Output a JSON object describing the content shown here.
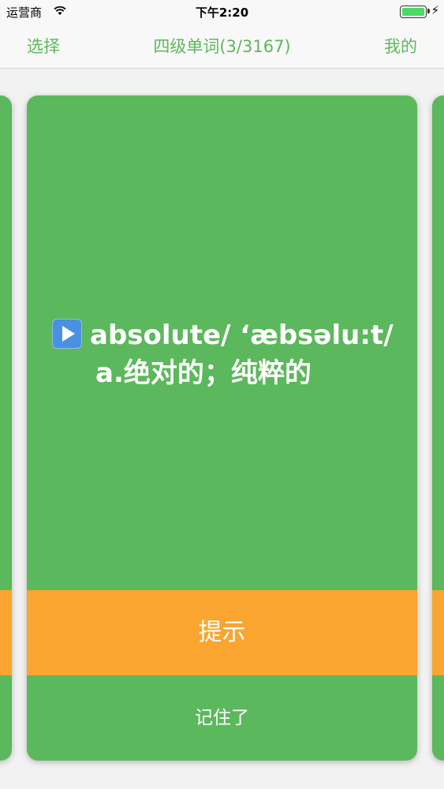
{
  "status": {
    "carrier": "运营商",
    "time": "下午2:20"
  },
  "nav": {
    "left": "选择",
    "title": "四级单词(3/3167)",
    "right": "我的"
  },
  "card": {
    "word": "absolute/ ‘æbsəlu:t/",
    "meaning": "a.绝对的；纯粹的",
    "hint_label": "提示",
    "remember_label": "记住了"
  },
  "colors": {
    "card_green": "#5cb85c",
    "hint_orange": "#f9a52f",
    "nav_green": "#5cb85c"
  },
  "icons": {
    "play": "play-icon",
    "wifi": "wifi-icon",
    "battery": "battery-icon"
  }
}
